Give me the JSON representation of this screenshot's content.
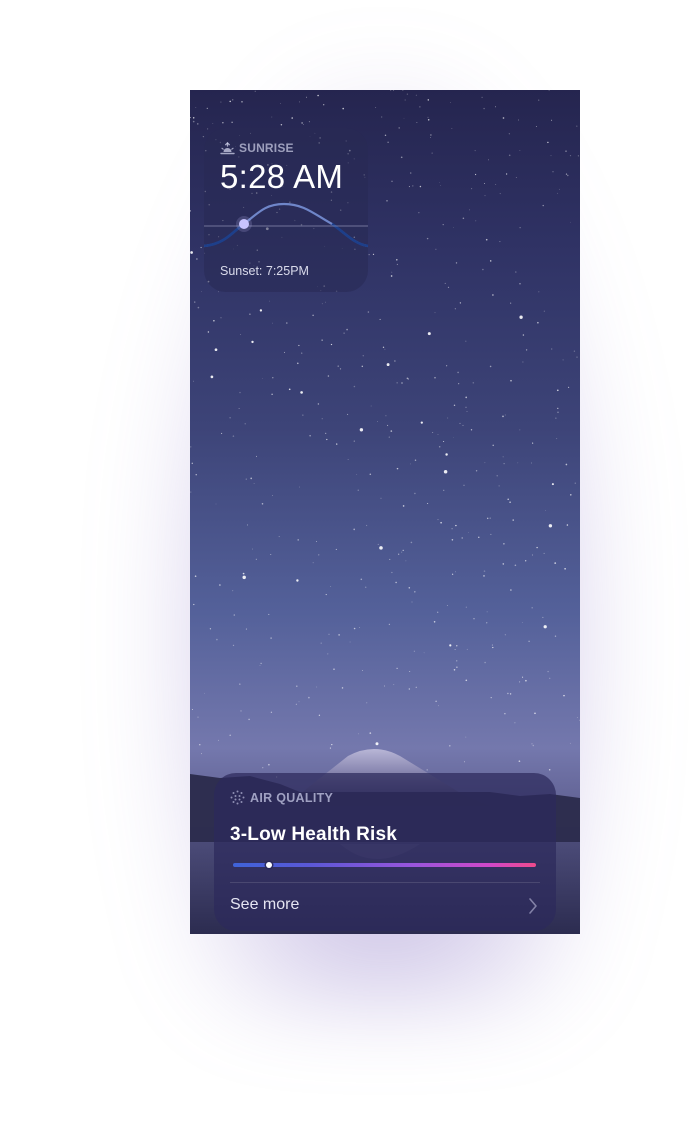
{
  "sunrise_widget": {
    "label": "SUNRISE",
    "icon": "sunrise-icon",
    "time": "5:28 AM",
    "sunset_text": "Sunset: 7:25PM"
  },
  "air_quality_widget": {
    "label": "AIR QUALITY",
    "icon": "air-quality-icon",
    "value_text": "3-Low Health Risk",
    "index_fraction": 0.12,
    "see_more_label": "See more",
    "chevron_icon": "chevron-right-icon"
  },
  "colors": {
    "scale_start": "#3f63d8",
    "scale_mid": "#9a55dc",
    "scale_end": "#ee4a8c",
    "sun_dot": "#c9c4ff",
    "sun_arc": "#6f86c9"
  }
}
